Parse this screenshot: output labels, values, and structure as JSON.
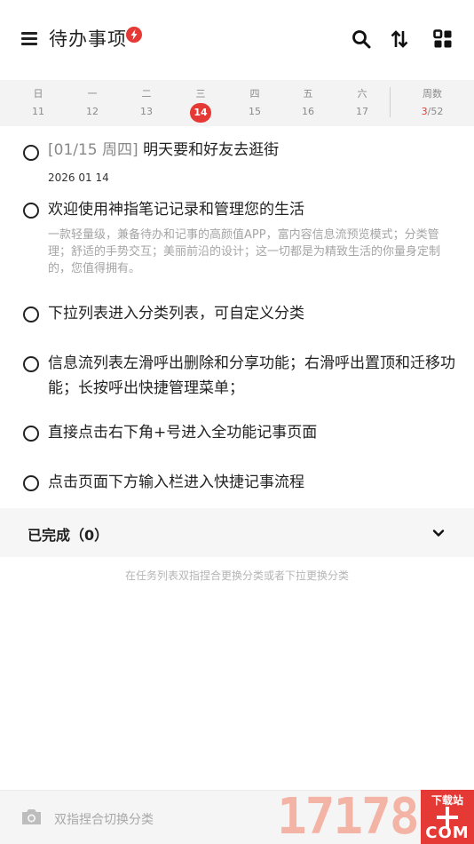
{
  "header": {
    "title": "待办事项",
    "icons": [
      "menu-icon",
      "flash-badge-icon",
      "search-icon",
      "sort-icon",
      "grid-view-icon"
    ],
    "accent_color": "#e53935"
  },
  "week": {
    "days": [
      {
        "name": "日",
        "num": "11"
      },
      {
        "name": "一",
        "num": "12"
      },
      {
        "name": "二",
        "num": "13"
      },
      {
        "name": "三",
        "num": "14"
      },
      {
        "name": "四",
        "num": "15"
      },
      {
        "name": "五",
        "num": "16"
      },
      {
        "name": "六",
        "num": "17"
      }
    ],
    "today_index": 3,
    "weeknum_label": "周数",
    "weeknum_current": "3",
    "weeknum_total": "/52"
  },
  "tasks": [
    {
      "date_prefix": "[01/15 周四]",
      "title": "明天要和好友去逛街",
      "sub": "2026 01 14"
    },
    {
      "title": "欢迎使用神指笔记记录和管理您的生活",
      "desc": "一款轻量级，兼备待办和记事的高颜值APP，富内容信息流预览模式；分类管理；舒适的手势交互；美丽前沿的设计；这一切都是为精致生活的你量身定制的，您值得拥有。"
    },
    {
      "title": "下拉列表进入分类列表，可自定义分类"
    },
    {
      "title": "信息流列表左滑呼出删除和分享功能；右滑呼出置顶和迁移功能；长按呼出快捷管理菜单；"
    },
    {
      "title": "直接点击右下角+号进入全功能记事页面"
    },
    {
      "title": "点击页面下方输入栏进入快捷记事流程"
    }
  ],
  "completed": {
    "label": "已完成（0）"
  },
  "hint": "在任务列表双指捏合更换分类或者下拉更换分类",
  "bottom_bar": {
    "placeholder": "双指捏合切换分类"
  },
  "watermark": {
    "text": "17178",
    "badge_top": "下载站",
    "badge_bottom": "COM"
  }
}
